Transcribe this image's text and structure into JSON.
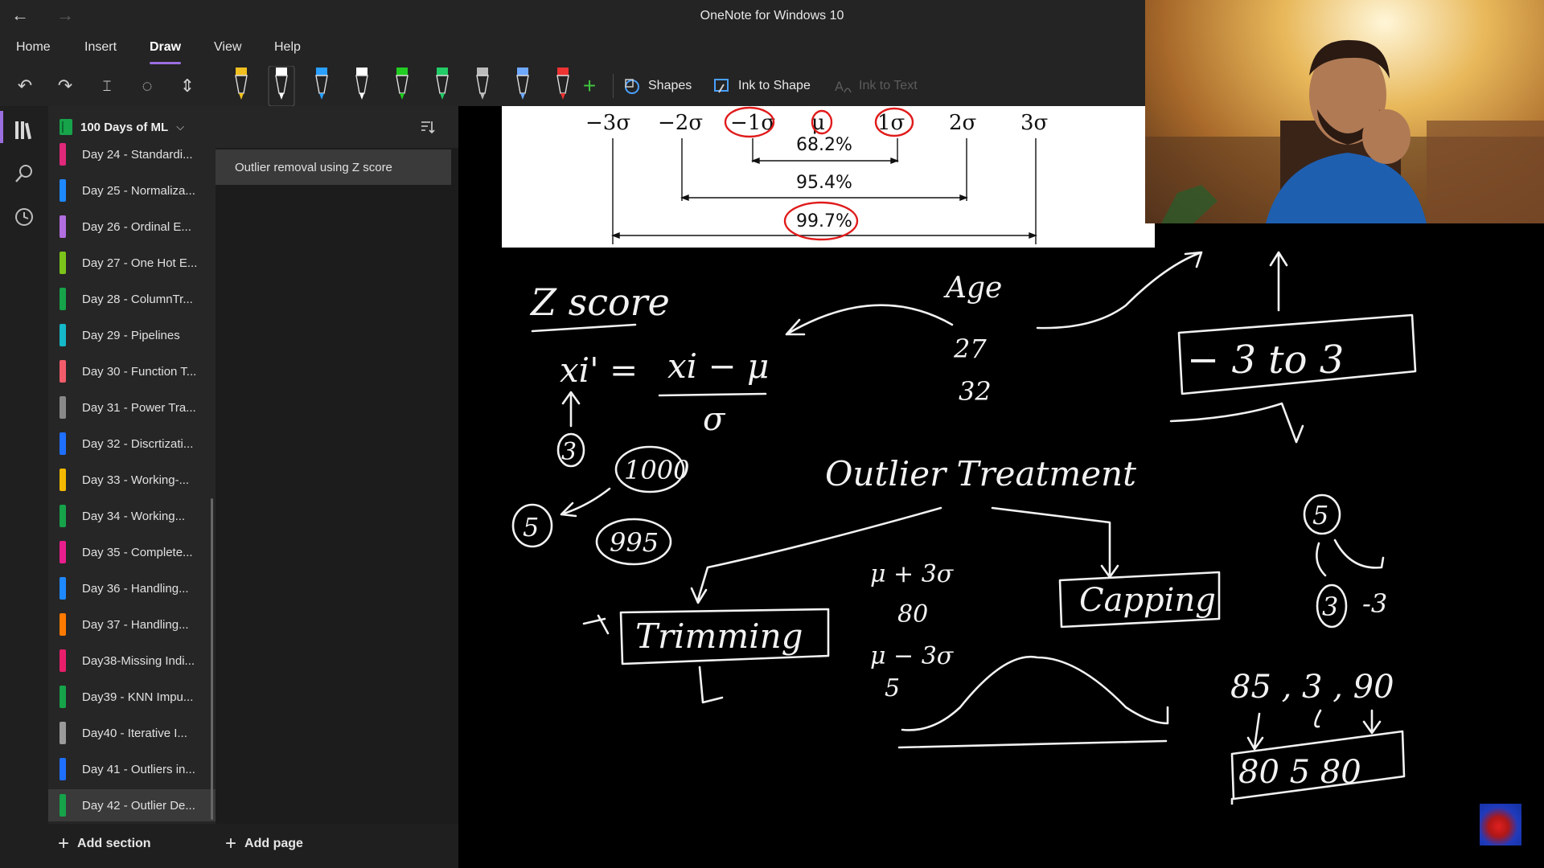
{
  "window": {
    "title": "OneNote for Windows 10"
  },
  "menu": {
    "tabs": [
      "Home",
      "Insert",
      "Draw",
      "View",
      "Help"
    ],
    "active": "Draw"
  },
  "toolbar": {
    "shapes_label": "Shapes",
    "ink_to_shape_label": "Ink to Shape",
    "ink_to_text_label": "Ink to Text",
    "pen_colors": [
      "#f0c020",
      "#ffffff",
      "#2aa0ff",
      "#ffffff",
      "#22cc22",
      "#22cc66",
      "#bbbbbb",
      "#6fa8ff",
      "#ee3333"
    ]
  },
  "notebook": {
    "name": "100 Days of ML",
    "sections": [
      {
        "label": "Day 24 - Standardi...",
        "color": "#e0287a"
      },
      {
        "label": "Day 25 - Normaliza...",
        "color": "#1e88ff"
      },
      {
        "label": "Day 26 - Ordinal E...",
        "color": "#b06ee0"
      },
      {
        "label": "Day 27 - One Hot E...",
        "color": "#7cc41a"
      },
      {
        "label": "Day 28 - ColumnTr...",
        "color": "#16a34a"
      },
      {
        "label": "Day 29 - Pipelines",
        "color": "#14b8c8"
      },
      {
        "label": "Day 30 - Function T...",
        "color": "#f25c6a"
      },
      {
        "label": "Day 31 - Power Tra...",
        "color": "#888888"
      },
      {
        "label": "Day 32 - Discrtizati...",
        "color": "#1e6fff"
      },
      {
        "label": "Day 33 - Working-...",
        "color": "#f5b800"
      },
      {
        "label": "Day 34 - Working...",
        "color": "#16a34a"
      },
      {
        "label": "Day 35 - Complete...",
        "color": "#e91e8c"
      },
      {
        "label": "Day 36 - Handling...",
        "color": "#1e88ff"
      },
      {
        "label": "Day 37 - Handling...",
        "color": "#ff7a00"
      },
      {
        "label": "Day38-Missing Indi...",
        "color": "#e91e6a"
      },
      {
        "label": "Day39 - KNN Impu...",
        "color": "#16a34a"
      },
      {
        "label": "Day40 - Iterative I...",
        "color": "#9a9a9a"
      },
      {
        "label": "Day 41 - Outliers in...",
        "color": "#1e6fff"
      },
      {
        "label": "Day 42 - Outlier De...",
        "color": "#16a34a"
      }
    ],
    "selected_section": 18,
    "pages": [
      {
        "label": "Outlier removal using Z score"
      }
    ]
  },
  "bottom": {
    "add_section": "Add section",
    "add_page": "Add page"
  },
  "canvas": {
    "normal_labels": [
      "−3σ",
      "−2σ",
      "−1σ",
      "μ",
      "1σ",
      "2σ",
      "3σ"
    ],
    "pct_1": "68.2%",
    "pct_2": "95.4%",
    "pct_3": "99.7%",
    "ink": {
      "zscore_title": "Z score",
      "formula_lhs": "xi' =",
      "formula_num": "xi − μ",
      "formula_den": "σ",
      "circle_3": "3",
      "circle_1000": "1000",
      "circle_5": "5",
      "circle_995": "995",
      "age": "Age",
      "age_1": "27",
      "age_2": "32",
      "range_box": "− 3  to  3",
      "outlier_treatment": "Outlier Treatment",
      "trimming": "Trimming",
      "capping": "Capping",
      "mu_plus": "μ + 3σ",
      "mu_plus_val": "80",
      "mu_minus": "μ − 3σ",
      "mu_minus_val": "5",
      "circle_5b": "5",
      "circle_3b": "3",
      "neg_3": "-3",
      "values_row": "85 , 3 , 90",
      "capped_row": "80    5    80"
    }
  }
}
